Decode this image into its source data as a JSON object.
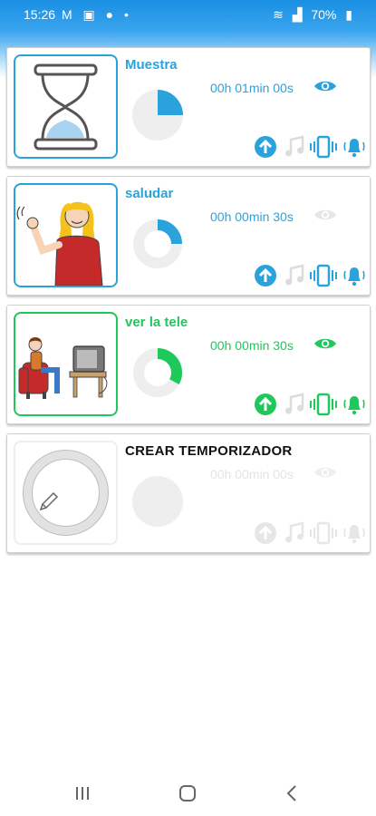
{
  "status": {
    "time": "15:26",
    "battery": "70%"
  },
  "timers": [
    {
      "title": "Muestra",
      "duration": "00h 01min 00s",
      "accent": "#2aa3dc",
      "progress": 0.25
    },
    {
      "title": "saludar",
      "duration": "00h 00min 30s",
      "accent": "#2aa3dc",
      "progress": 0.25
    },
    {
      "title": "ver la tele",
      "duration": "00h 00min 30s",
      "accent": "#1ec85a",
      "progress": 0.33
    }
  ],
  "create": {
    "title": "CREAR TEMPORIZADOR",
    "duration": "00h 00min 00s"
  },
  "icons": {
    "actions": [
      "upload-icon",
      "music-icon",
      "vibrate-icon",
      "bell-icon"
    ],
    "nav": [
      "recent-apps-icon",
      "home-icon",
      "back-icon"
    ]
  },
  "colors": {
    "blue": "#2aa3dc",
    "green": "#1ec85a",
    "disabled": "#dcdcdc"
  }
}
